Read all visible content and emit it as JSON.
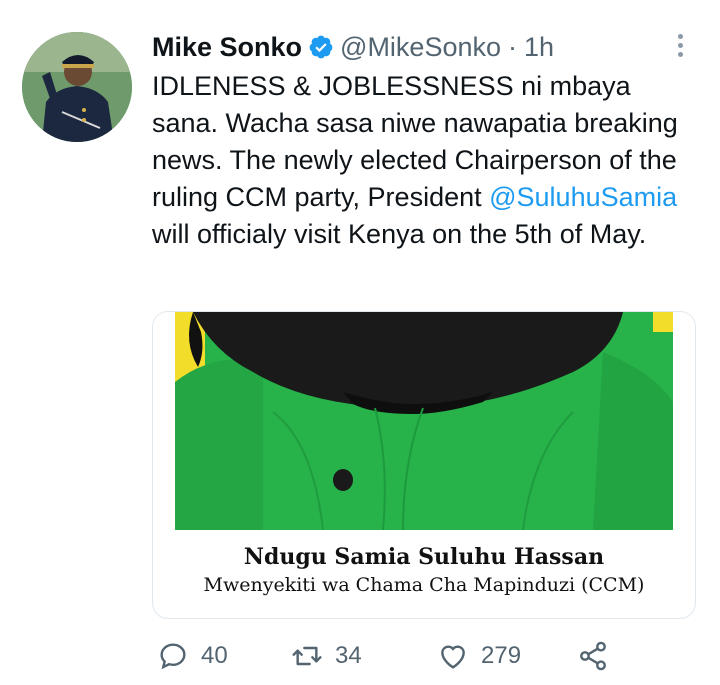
{
  "tweet": {
    "author_name": "Mike Sonko",
    "handle": "@MikeSonko",
    "separator": "·",
    "time": "1h",
    "text_part1": "IDLENESS & JOBLESSNESS ni mbaya sana. Wacha sasa niwe nawapatia breaking news. The newly elected Chairperson of the ruling CCM party, President ",
    "mention": "@SuluhuSamia",
    "text_part2": " will officialy visit Kenya on the 5th of May."
  },
  "media": {
    "caption_title": "Ndugu Samia Suluhu Hassan",
    "caption_subtitle": "Mwenyekiti wa Chama Cha Mapinduzi (CCM)"
  },
  "actions": {
    "replies": "40",
    "retweets": "34",
    "likes": "279"
  },
  "icons": {
    "verified": "verified-badge-icon",
    "more": "more-vertical-icon",
    "reply": "reply-icon",
    "retweet": "retweet-icon",
    "like": "heart-icon",
    "share": "share-icon"
  },
  "colors": {
    "link": "#1d9bf0",
    "secondary_text": "#536471",
    "primary_text": "#0f1419",
    "jacket_green": "#27b24a"
  }
}
